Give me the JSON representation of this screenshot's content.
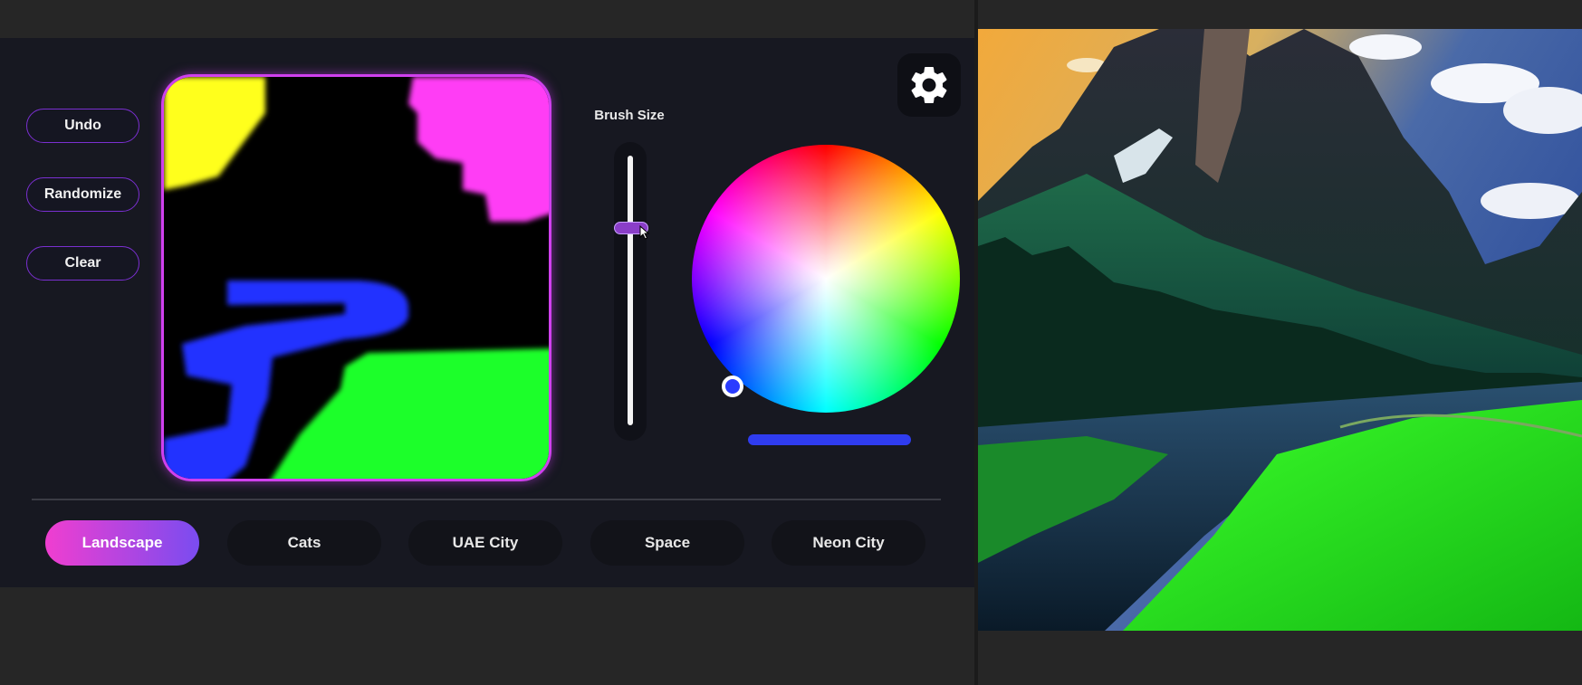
{
  "controls": {
    "undo_label": "Undo",
    "randomize_label": "Randomize",
    "clear_label": "Clear"
  },
  "brush": {
    "label": "Brush Size",
    "size_fraction": 0.73
  },
  "color_picker": {
    "selected_color": "#2f3cf0"
  },
  "tabs": [
    {
      "label": "Landscape",
      "active": true
    },
    {
      "label": "Cats",
      "active": false
    },
    {
      "label": "UAE City",
      "active": false
    },
    {
      "label": "Space",
      "active": false
    },
    {
      "label": "Neon City",
      "active": false
    }
  ],
  "icons": {
    "settings": "gear-icon"
  },
  "colors": {
    "accent_pink": "#f03ed0",
    "accent_purple": "#7a4cf0",
    "panel_bg": "#171821",
    "paint_yellow": "#ffff1a",
    "paint_pink": "#ff3cf5",
    "paint_blue": "#2233ff",
    "paint_green": "#1eff2a"
  }
}
